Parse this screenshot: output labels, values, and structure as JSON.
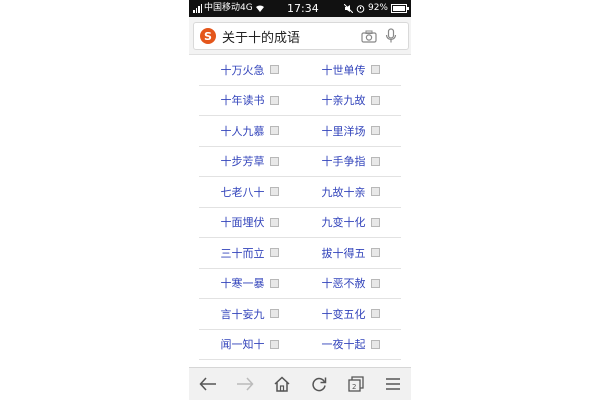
{
  "status_bar": {
    "carrier": "中国移动4G",
    "time": "17:34",
    "battery": "92%"
  },
  "search": {
    "logo_letter": "S",
    "query": "关于十的成语"
  },
  "idioms": [
    [
      "十万火急",
      "十世单传"
    ],
    [
      "十年读书",
      "十亲九故"
    ],
    [
      "十人九慕",
      "十里洋场"
    ],
    [
      "十步芳草",
      "十手争指"
    ],
    [
      "七老八十",
      "九故十亲"
    ],
    [
      "十面埋伏",
      "九变十化"
    ],
    [
      "三十而立",
      "拔十得五"
    ],
    [
      "十寒一暴",
      "十恶不赦"
    ],
    [
      "言十妄九",
      "十变五化"
    ],
    [
      "闻一知十",
      "一夜十起"
    ]
  ],
  "icons": {
    "camera": "camera-icon",
    "mic": "microphone-icon",
    "back": "back-arrow-icon",
    "forward": "forward-arrow-icon",
    "home": "home-icon",
    "refresh": "refresh-icon",
    "tabs": "tabs-icon",
    "menu": "menu-icon"
  },
  "colors": {
    "link": "#3344bb",
    "logo": "#e4561b"
  }
}
